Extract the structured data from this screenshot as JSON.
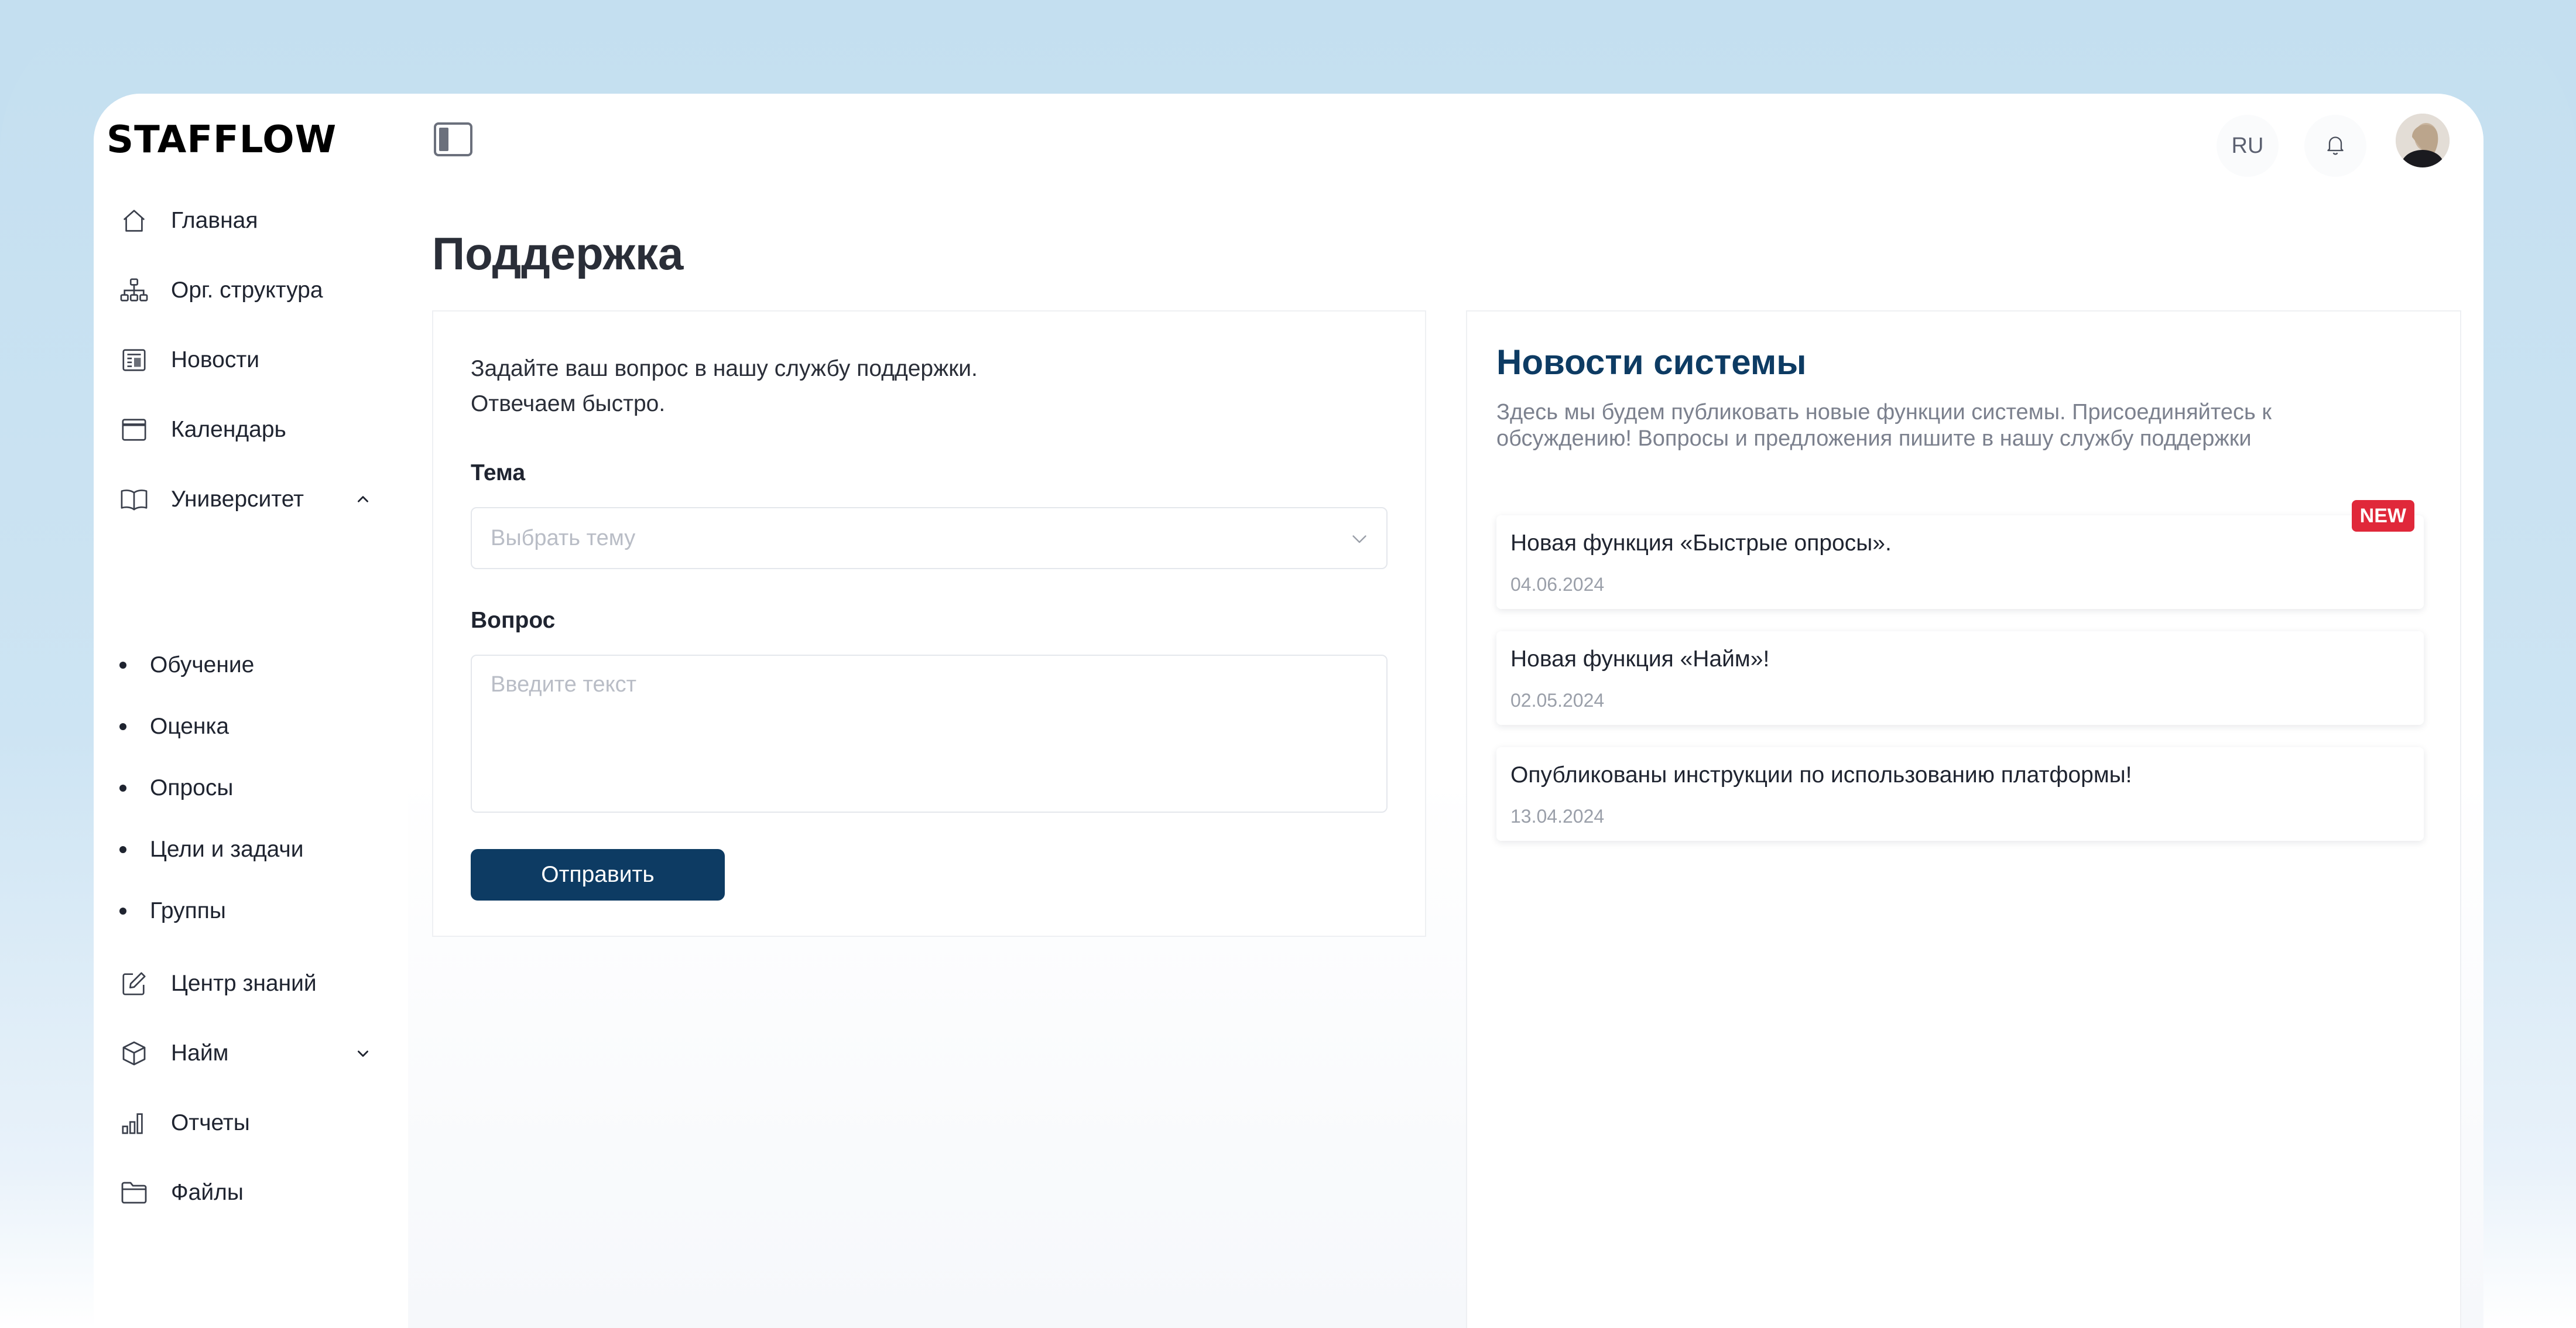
{
  "app": {
    "logo": "STAFFLOW"
  },
  "sidebar": {
    "items": [
      {
        "label": "Главная",
        "icon": "home-icon"
      },
      {
        "label": "Орг. структура",
        "icon": "org-structure-icon"
      },
      {
        "label": "Новости",
        "icon": "newspaper-icon"
      },
      {
        "label": "Календарь",
        "icon": "calendar-icon"
      },
      {
        "label": "Университет",
        "icon": "book-icon",
        "expanded": true,
        "children": [
          "Обучение",
          "Оценка",
          "Опросы",
          "Цели и задачи",
          "Группы"
        ]
      },
      {
        "label": "Центр знаний",
        "icon": "edit-icon"
      },
      {
        "label": "Найм",
        "icon": "cube-icon",
        "expanded": false
      },
      {
        "label": "Отчеты",
        "icon": "bar-chart-icon"
      },
      {
        "label": "Файлы",
        "icon": "folder-icon"
      }
    ]
  },
  "header": {
    "language": "RU",
    "notifications_icon": "bell-icon",
    "avatar_icon": "avatar"
  },
  "page": {
    "title": "Поддержка"
  },
  "support": {
    "intro_line1": "Задайте ваш вопрос в нашу службу поддержки.",
    "intro_line2": "Отвечаем быстро.",
    "topic_label": "Тема",
    "topic_placeholder": "Выбрать тему",
    "question_label": "Вопрос",
    "question_placeholder": "Введите текст",
    "submit_label": "Отправить"
  },
  "news": {
    "title": "Новости системы",
    "description": "Здесь мы будем публиковать новые функции системы. Присоединяйтесь к обсуждению! Вопросы и предложения пишите в нашу службу поддержки",
    "items": [
      {
        "title": "Новая функция «Быстрые опросы».",
        "date": "04.06.2024",
        "badge": "NEW"
      },
      {
        "title": "Новая функция «Найм»!",
        "date": "02.05.2024"
      },
      {
        "title": "Опубликованы инструкции по использованию платформы!",
        "date": "13.04.2024"
      }
    ]
  },
  "colors": {
    "accent": "#0d3b63",
    "badge": "#e0283a",
    "background": "#c4dff0"
  }
}
